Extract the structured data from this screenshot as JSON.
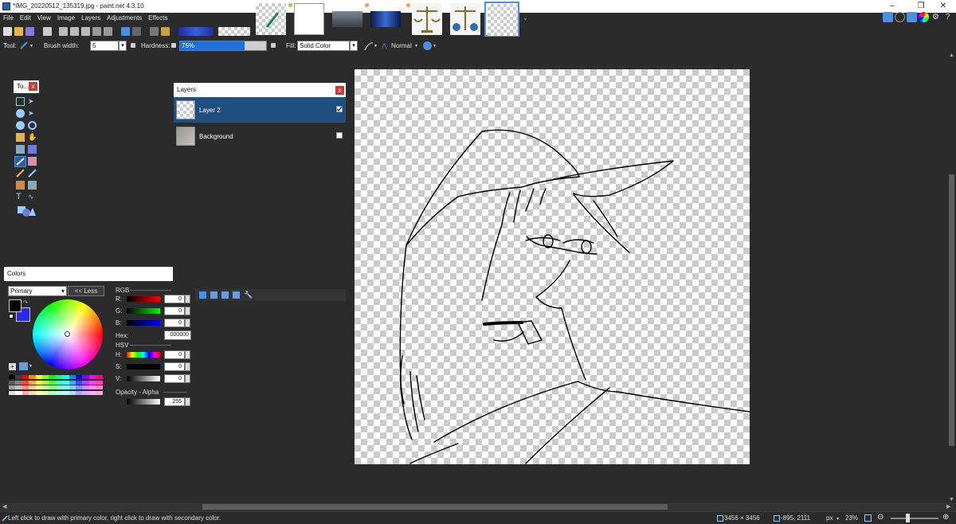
{
  "window": {
    "title": "*IMG_20220512_135319.jpg - paint.net 4.3.10",
    "minimize": "–",
    "restore": "❐",
    "close": "✕"
  },
  "menu": [
    "File",
    "Edit",
    "View",
    "Image",
    "Layers",
    "Adjustments",
    "Effects"
  ],
  "toolbar": {
    "tool_label": "Tool:",
    "brush_width_label": "Brush width:",
    "brush_width_value": "5",
    "hardness_label": "Hardness:",
    "hardness_value": "75%",
    "hardness_fraction": 0.75,
    "fill_label": "Fill:",
    "fill_value": "Solid Color",
    "blend_mode": "Normal"
  },
  "tools_panel": {
    "title": "To...",
    "close": "x"
  },
  "layers_panel": {
    "title": "Layers",
    "close": "x",
    "layers": [
      {
        "name": "Layer 2",
        "selected": true,
        "visible": true
      },
      {
        "name": "Background",
        "selected": false,
        "visible": false
      }
    ]
  },
  "colors_panel": {
    "title": "Colors",
    "mode": "Primary",
    "less_button": "<< Less",
    "rgb_label": "RGB",
    "r_label": "R:",
    "g_label": "G:",
    "b_label": "B:",
    "r": "0",
    "g": "0",
    "b": "0",
    "hex_label": "Hex:",
    "hex": "000000",
    "hsv_label": "HSV",
    "h_label": "H:",
    "s_label": "S:",
    "v_label": "V:",
    "h": "0",
    "s": "0",
    "v": "0",
    "opacity_label": "Opacity - Alpha",
    "alpha": "255",
    "primary_color": "#000000",
    "secondary_color": "#2a2ae6"
  },
  "status": {
    "hint": "Left click to draw with primary color, right click to draw with secondary color.",
    "image_size": "3456 × 3456",
    "cursor": "-895, 2111",
    "unit": "px",
    "zoom": "23%"
  },
  "colors": {
    "accent": "#1f6fd6",
    "selected_layer": "#1f4e80",
    "close": "#c93a3a"
  }
}
